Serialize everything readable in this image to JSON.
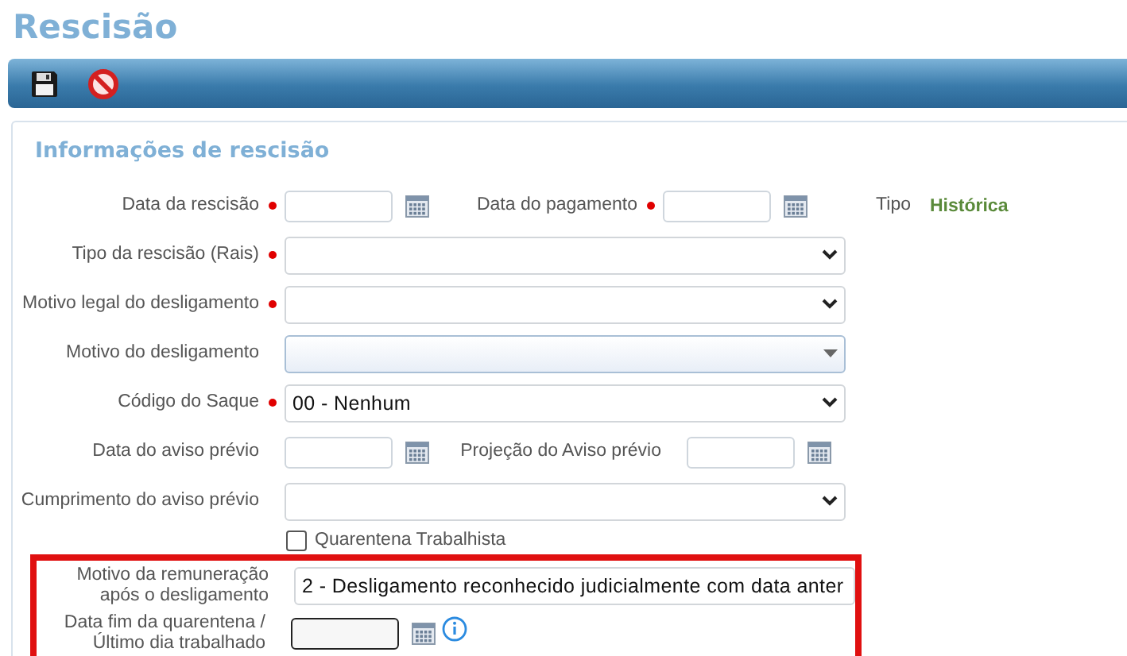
{
  "page": {
    "title": "Rescisão"
  },
  "panel": {
    "title": "Informações de rescisão"
  },
  "rows": [
    {
      "kind": "dates",
      "fields": [
        {
          "label": "Data da rescisão",
          "required": true
        },
        {
          "label": "Data do pagamento",
          "required": true
        }
      ],
      "info": {
        "label": "Tipo",
        "value": "Histórica"
      }
    },
    {
      "kind": "select",
      "label": "Tipo da rescisão (Rais)",
      "required": true
    },
    {
      "kind": "select",
      "label": "Motivo legal do desligamento",
      "required": true
    },
    {
      "kind": "combo",
      "label": "Motivo do desligamento",
      "required": false
    },
    {
      "kind": "select",
      "label": "Código do Saque",
      "required": true,
      "value": "00 - Nenhum"
    },
    {
      "kind": "dates",
      "fields": [
        {
          "label": "Data do aviso prévio",
          "required": false
        },
        {
          "label": "Projeção do Aviso prévio",
          "required": false
        }
      ]
    },
    {
      "kind": "select",
      "label": "Cumprimento do aviso prévio",
      "required": false
    },
    {
      "kind": "checkbox",
      "label": "Quarentena Trabalhista",
      "checked": false
    }
  ],
  "highlighted_rows": [
    {
      "kind": "select",
      "label": "Motivo da remuneração após o desligamento",
      "required": false,
      "value": "2 - Desligamento reconhecido judicialmente com data anter"
    },
    {
      "kind": "date",
      "label": "Data fim da quarentena / Último dia trabalhado",
      "required": false,
      "focused": true,
      "info_icon": true
    }
  ]
}
